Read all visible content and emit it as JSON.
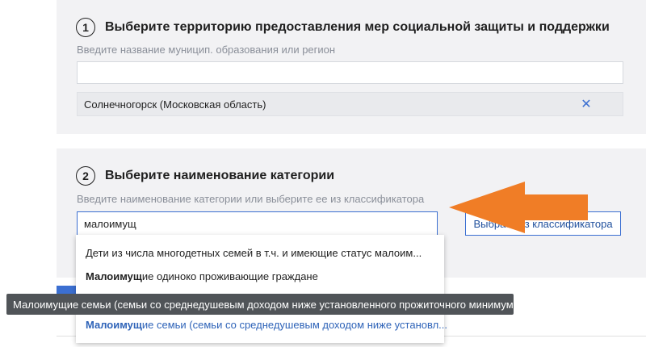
{
  "step1": {
    "number": "1",
    "title": "Выберите территорию предоставления мер социальной защиты и поддержки",
    "hint": "Введите название муницип. образования или регион",
    "input_value": "",
    "selected": "Солнечногорск (Московская область)",
    "remove_icon": "close-icon"
  },
  "step2": {
    "number": "2",
    "title": "Выберите наименование категории",
    "hint": "Введите наименование категории или выберите ее из классификатора",
    "input_value": "малоимущ",
    "classifier_button": "Выбрать из классификатора"
  },
  "dropdown": {
    "items": [
      {
        "bold": "",
        "rest": "Дети из числа многодетных семей в т.ч. и имеющие статус малоим..."
      },
      {
        "bold": "Малоимущ",
        "rest": "ие одиноко проживающие граждане"
      },
      {
        "bold": "Малоимущ",
        "rest": "ие семьи (семьи со среднедушевым доходом ниже установл..."
      }
    ]
  },
  "tooltip": "Малоимущие семьи (семьи со среднедушевым доходом ниже установленного прожиточного минимума)",
  "colors": {
    "accent": "#3b6fd1",
    "arrow": "#f07d26",
    "section_bg": "#f2f2f4",
    "tooltip_bg": "#505458"
  }
}
